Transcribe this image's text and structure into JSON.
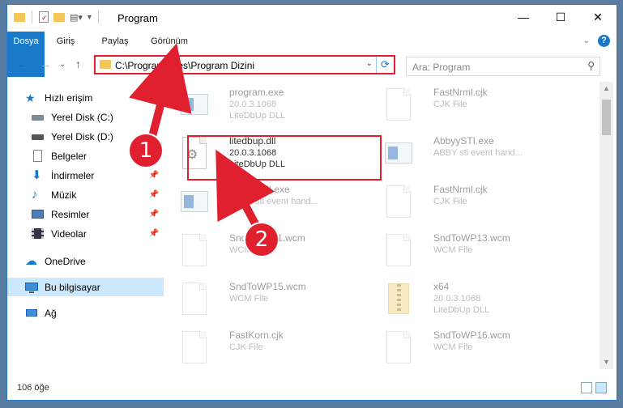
{
  "window": {
    "title": "Program"
  },
  "ribbon": {
    "tabs": [
      "Dosya",
      "Giriş",
      "Paylaş",
      "Görünüm"
    ]
  },
  "address": {
    "path": "C:\\Program Files\\Program Dizini"
  },
  "search": {
    "placeholder": "Ara: Program"
  },
  "nav": {
    "items": [
      {
        "label": "Hızlı erişim",
        "icon": "star-icon"
      },
      {
        "label": "Yerel Disk (C:)",
        "icon": "drive-icon"
      },
      {
        "label": "Yerel Disk (D:)",
        "icon": "drive-icon"
      },
      {
        "label": "Belgeler",
        "icon": "document-icon"
      },
      {
        "label": "İndirmeler",
        "icon": "download-icon"
      },
      {
        "label": "Müzik",
        "icon": "music-icon"
      },
      {
        "label": "Resimler",
        "icon": "pictures-icon"
      },
      {
        "label": "Videolar",
        "icon": "video-icon"
      },
      {
        "label": "OneDrive",
        "icon": "cloud-icon"
      },
      {
        "label": "Bu bilgisayar",
        "icon": "computer-icon"
      },
      {
        "label": "Ağ",
        "icon": "network-icon"
      }
    ]
  },
  "files": [
    {
      "name": "program.exe",
      "sub1": "20.0.3.1068",
      "sub2": "LiteDbUp DLL",
      "kind": "exe"
    },
    {
      "name": "FastNrml.cjk",
      "sub1": "CJK File",
      "sub2": "",
      "kind": "doc"
    },
    {
      "name": "litedbup.dll",
      "sub1": "20.0.3.1068",
      "sub2": "LiteDbUp DLL",
      "kind": "dll"
    },
    {
      "name": "AbbyySTI.exe",
      "sub1": "ABBY sti event hand...",
      "sub2": "",
      "kind": "exe"
    },
    {
      "name": "AbbyySTI.exe",
      "sub1": "ABBY sti event hand...",
      "sub2": "",
      "kind": "exe"
    },
    {
      "name": "FastNrml.cjk",
      "sub1": "CJK File",
      "sub2": "",
      "kind": "doc"
    },
    {
      "name": "SndToWP11.wcm",
      "sub1": "WCM File",
      "sub2": "",
      "kind": "doc"
    },
    {
      "name": "SndToWP13.wcm",
      "sub1": "WCM File",
      "sub2": "",
      "kind": "doc"
    },
    {
      "name": "SndToWP15.wcm",
      "sub1": "WCM File",
      "sub2": "",
      "kind": "doc"
    },
    {
      "name": "x64",
      "sub1": "20.0.3.1068",
      "sub2": "LiteDbUp DLL",
      "kind": "zip"
    },
    {
      "name": "FastKorn.cjk",
      "sub1": "CJK File",
      "sub2": "",
      "kind": "doc"
    },
    {
      "name": "SndToWP16.wcm",
      "sub1": "WCM File",
      "sub2": "",
      "kind": "doc"
    }
  ],
  "status": {
    "count": "106 öğe"
  },
  "annotations": {
    "step1": "1",
    "step2": "2"
  },
  "colors": {
    "accent": "#1979ca",
    "highlight": "#e0202e"
  }
}
